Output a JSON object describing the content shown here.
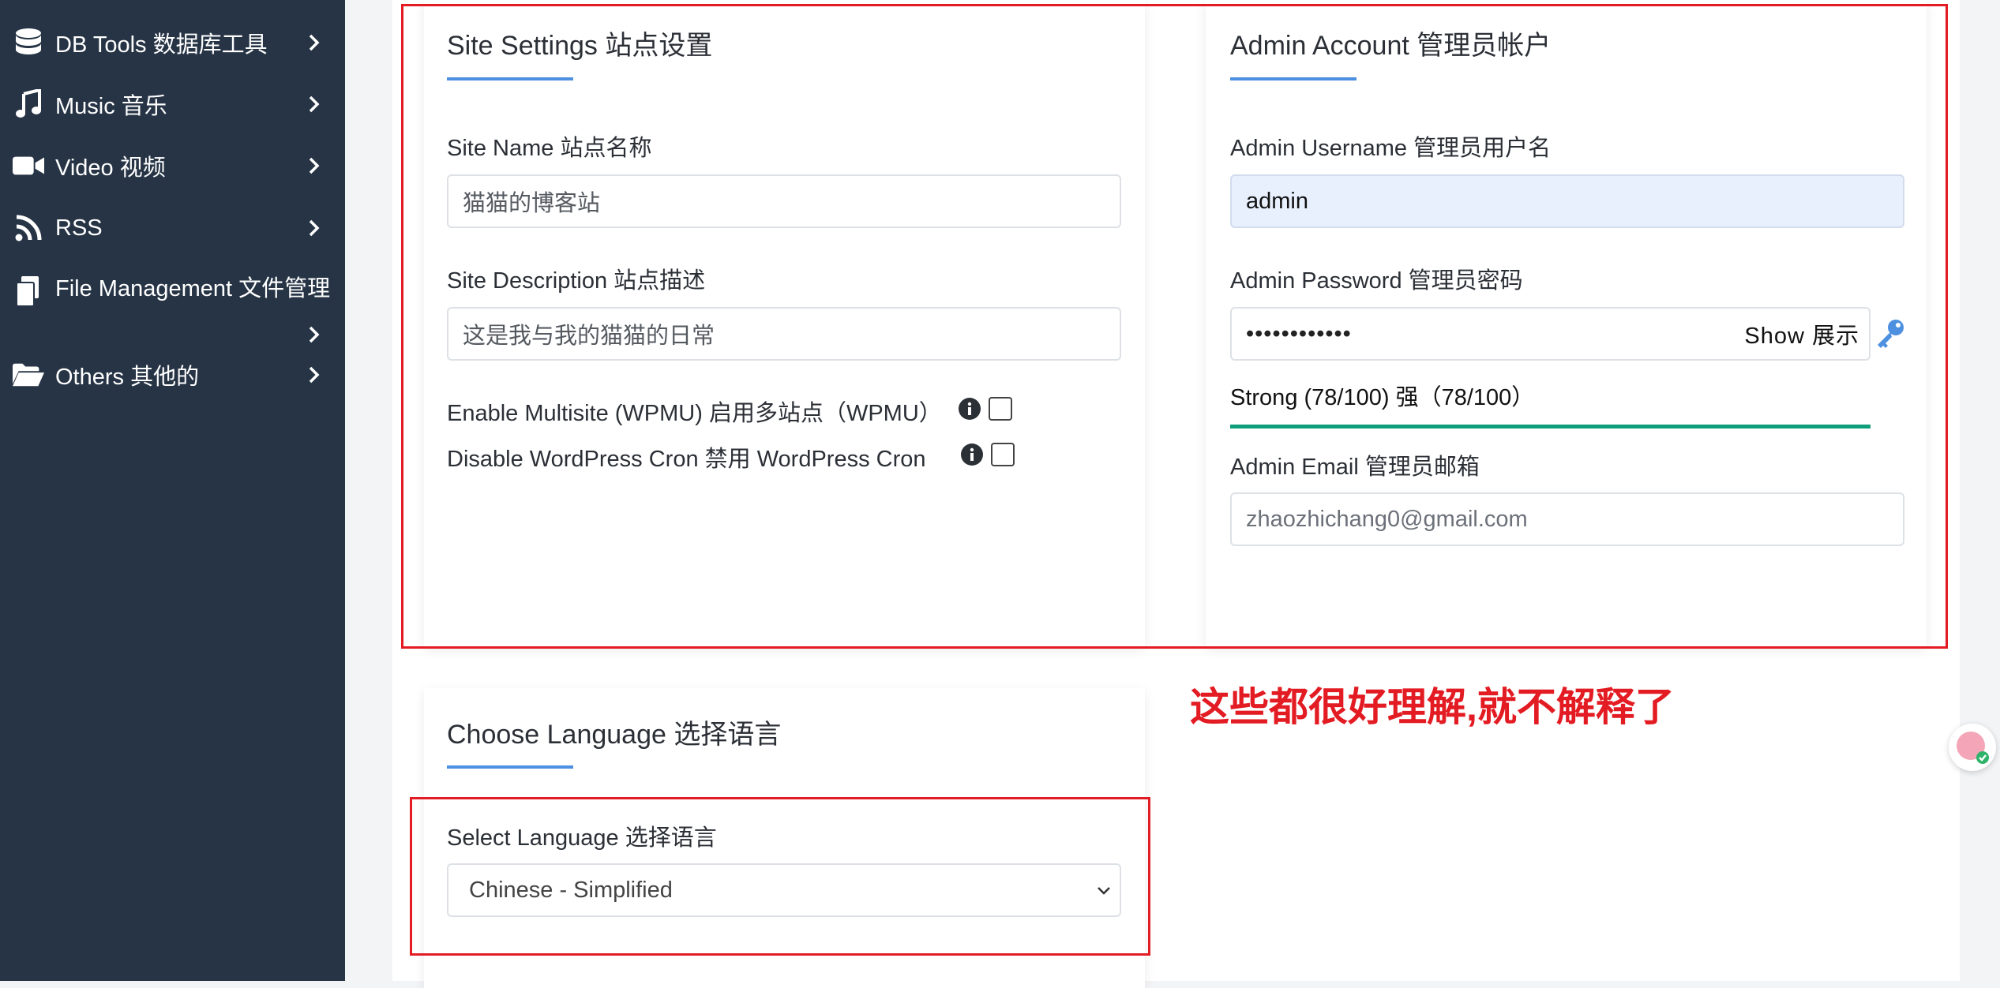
{
  "sidebar": {
    "items": [
      {
        "label": "DB Tools  数据库工具",
        "icon": "database-icon"
      },
      {
        "label": "Music  音乐",
        "icon": "music-icon"
      },
      {
        "label": "Video  视频",
        "icon": "video-icon"
      },
      {
        "label": "RSS",
        "icon": "rss-icon"
      },
      {
        "label": "File Management  文件管理",
        "icon": "file-icon"
      },
      {
        "label": "Others  其他的",
        "icon": "folder-open-icon"
      }
    ]
  },
  "site_settings": {
    "title": "Site Settings  站点设置",
    "site_name_label": "Site Name  站点名称",
    "site_name_value": "猫猫的博客站",
    "site_desc_label": "Site Description  站点描述",
    "site_desc_value": "这是我与我的猫猫的日常",
    "multisite_label": "Enable Multisite (WPMU)  启用多站点（WPMU）",
    "disable_cron_label": "Disable WordPress Cron  禁用 WordPress Cron"
  },
  "admin_account": {
    "title": "Admin Account  管理员帐户",
    "username_label": "Admin Username  管理员用户名",
    "username_value": "admin",
    "password_label": "Admin Password  管理员密码",
    "password_value": "••••••••••••",
    "show_label": "Show  展示",
    "strength_text": "Strong (78/100)  强（78/100）",
    "strength_value": 78,
    "email_label": "Admin Email  管理员邮箱",
    "email_value": "zhaozhichang0@gmail.com"
  },
  "language": {
    "title": "Choose Language  选择语言",
    "select_label": "Select Language  选择语言",
    "selected": "Chinese - Simplified"
  },
  "annotation": "这些都很好理解,就不解释了",
  "colors": {
    "sidebar_bg": "#263445",
    "accent": "#4d8fe0",
    "annotation_red": "#e31b23",
    "strength_bar": "#0f9d7a"
  }
}
